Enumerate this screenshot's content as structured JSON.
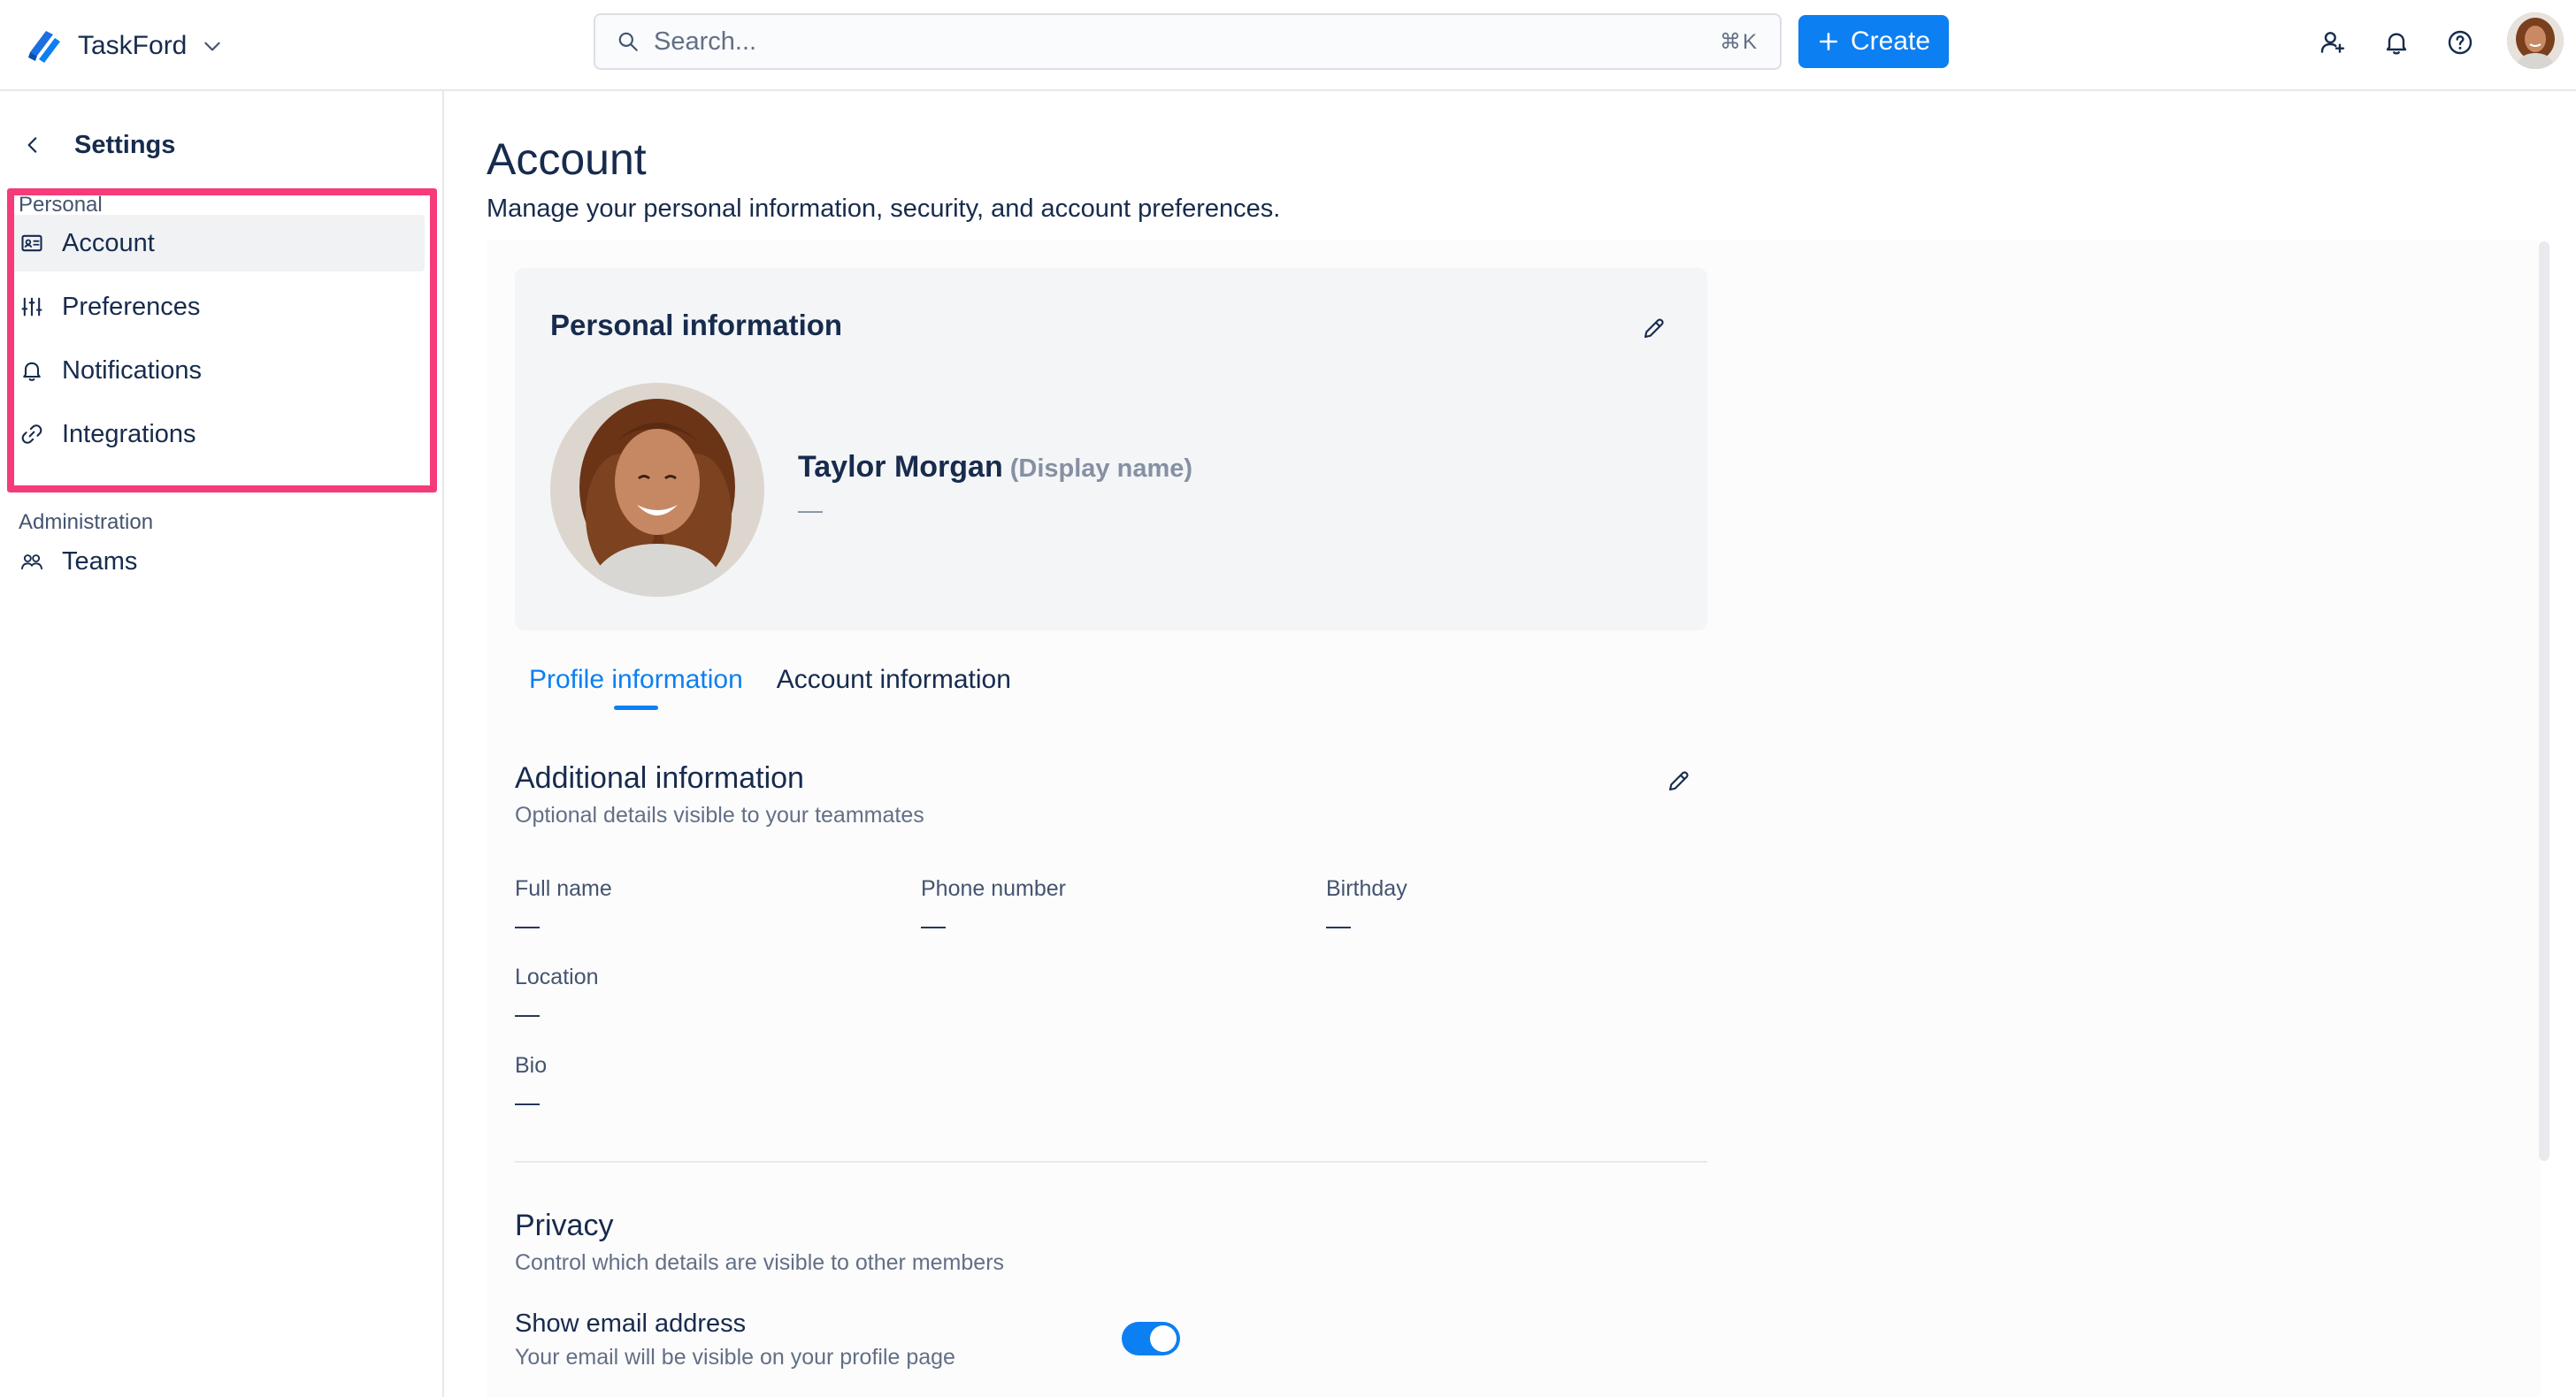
{
  "app": {
    "name": "TaskFord",
    "brand_color": "#0c7ff2"
  },
  "topbar": {
    "search_placeholder": "Search...",
    "search_shortcut": "⌘K",
    "create_label": "Create",
    "icons": [
      "add-people-icon",
      "bell-icon",
      "help-icon"
    ]
  },
  "sidebar": {
    "title": "Settings",
    "sections": [
      {
        "label": "Personal",
        "items": [
          {
            "label": "Account",
            "icon": "id-card-icon",
            "active": true
          },
          {
            "label": "Preferences",
            "icon": "sliders-icon",
            "active": false
          },
          {
            "label": "Notifications",
            "icon": "bell-icon",
            "active": false
          },
          {
            "label": "Integrations",
            "icon": "link-icon",
            "active": false
          }
        ]
      },
      {
        "label": "Administration",
        "items": [
          {
            "label": "Teams",
            "icon": "team-icon",
            "active": false
          }
        ]
      }
    ]
  },
  "main": {
    "title": "Account",
    "subtitle": "Manage your personal information, security, and account preferences.",
    "personal_card": {
      "title": "Personal information",
      "display_name": "Taylor Morgan",
      "display_name_suffix": "(Display name)",
      "sub_value": "—"
    },
    "tabs": [
      {
        "label": "Profile information",
        "active": true
      },
      {
        "label": "Account information",
        "active": false
      }
    ],
    "additional": {
      "title": "Additional information",
      "description": "Optional details visible to your teammates",
      "fields": [
        {
          "label": "Full name",
          "value": "—"
        },
        {
          "label": "Phone number",
          "value": "—"
        },
        {
          "label": "Birthday",
          "value": "—"
        },
        {
          "label": "Location",
          "value": "—"
        },
        {
          "label": "Bio",
          "value": "—"
        }
      ]
    },
    "privacy": {
      "title": "Privacy",
      "description": "Control which details are visible to other members",
      "toggles": [
        {
          "label": "Show email address",
          "description": "Your email will be visible on your profile page",
          "on": true
        }
      ]
    }
  }
}
